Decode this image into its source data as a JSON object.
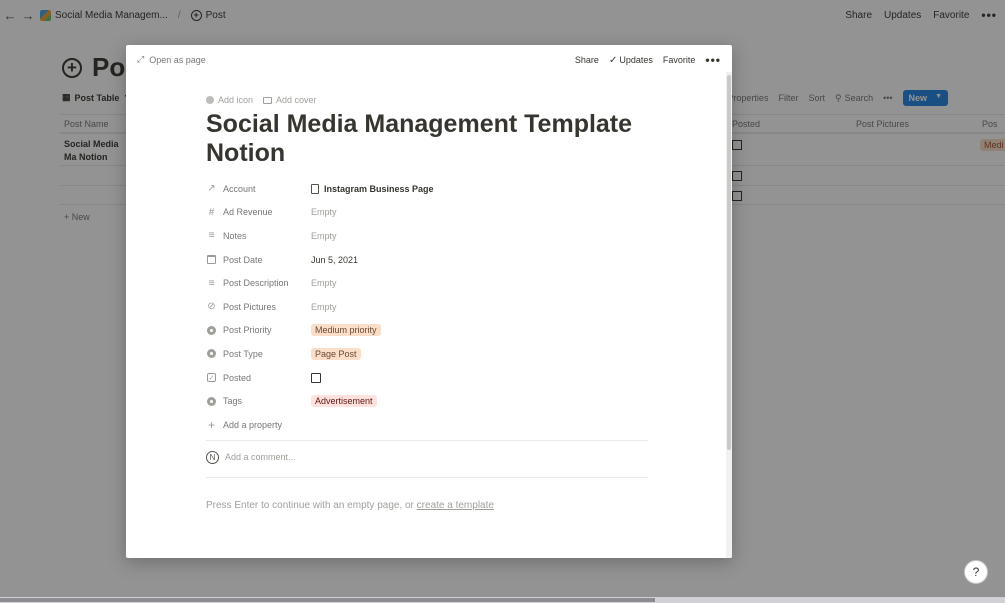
{
  "topbar": {
    "breadcrumb_workspace": "Social Media Managem...",
    "breadcrumb_separator": "/",
    "breadcrumb_page": "Post",
    "share": "Share",
    "updates": "Updates",
    "favorite": "Favorite",
    "more": "•••"
  },
  "background": {
    "title": "Pos",
    "view_name": "Post Table",
    "toolbar": {
      "properties": "Properties",
      "filter": "Filter",
      "sort": "Sort",
      "search": "Search",
      "more": "•••",
      "new": "New"
    },
    "columns": {
      "post_name": "Post Name",
      "posted": "Posted",
      "post_pictures": "Post Pictures",
      "next": "Pos"
    },
    "row1_name": "Social Media Ma Notion",
    "row1_tag": "Medi",
    "new_row": "+ New",
    "help": "?"
  },
  "modal": {
    "open_as_page": "Open as page",
    "share": "Share",
    "updates": "Updates",
    "favorite": "Favorite",
    "more": "•••",
    "add_icon": "Add icon",
    "add_cover": "Add cover",
    "title": "Social Media Management Template Notion",
    "properties": [
      {
        "name": "Account",
        "icon": "arrow-relation-icon",
        "value": "Instagram Business Page",
        "kind": "relation"
      },
      {
        "name": "Ad Revenue",
        "icon": "number-icon",
        "value": "Empty",
        "kind": "empty"
      },
      {
        "name": "Notes",
        "icon": "text-icon",
        "value": "Empty",
        "kind": "empty"
      },
      {
        "name": "Post Date",
        "icon": "calendar-icon",
        "value": "Jun 5, 2021",
        "kind": "text"
      },
      {
        "name": "Post Description",
        "icon": "text-icon",
        "value": "Empty",
        "kind": "empty"
      },
      {
        "name": "Post Pictures",
        "icon": "attachment-icon",
        "value": "Empty",
        "kind": "empty"
      },
      {
        "name": "Post Priority",
        "icon": "select-icon",
        "value": "Medium priority",
        "kind": "tag-orange"
      },
      {
        "name": "Post Type",
        "icon": "select-icon",
        "value": "Page Post",
        "kind": "tag-orange"
      },
      {
        "name": "Posted",
        "icon": "checkbox-icon",
        "value": "",
        "kind": "checkbox"
      },
      {
        "name": "Tags",
        "icon": "select-icon",
        "value": "Advertisement",
        "kind": "tag-red"
      }
    ],
    "add_property": "Add a property",
    "comment_avatar": "N",
    "comment_placeholder": "Add a comment...",
    "hint_text": "Press Enter to continue with an empty page, or ",
    "hint_link": "create a template"
  }
}
